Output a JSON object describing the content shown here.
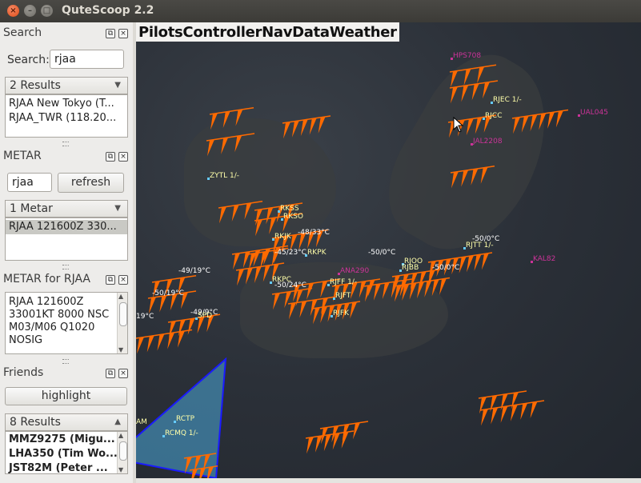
{
  "window": {
    "title": "QuteScoop 2.2"
  },
  "colors": {
    "titlebar": "#3c3b37",
    "wind_barb": "#ff6a00",
    "pilot": "#cc3399",
    "airport": "#ffffaa",
    "fir": "#4aa8d8"
  },
  "search": {
    "title": "Search",
    "label": "Search:",
    "value": "rjaa",
    "results_label": "2 Results",
    "results": [
      "RJAA New Tokyo (T...",
      "RJAA_TWR (118.20..."
    ]
  },
  "metar": {
    "title": "METAR",
    "input_value": "rjaa",
    "refresh_label": "refresh",
    "count_label": "1 Metar",
    "items": [
      "RJAA 121600Z 330..."
    ]
  },
  "metar_for": {
    "title": "METAR for RJAA",
    "lines": [
      "RJAA 121600Z",
      "33001KT 8000 NSC",
      "M03/M06 Q1020",
      "NOSIG"
    ]
  },
  "friends": {
    "title": "Friends",
    "highlight_label": "highlight",
    "count_label": "8 Results",
    "items": [
      "MMZ9275 (Migu...",
      "LHA350 (Tim Wo...",
      "JST82M (Peter ..."
    ]
  },
  "map": {
    "menu": [
      "Pilots",
      "Controller",
      "NavData",
      "Weather"
    ],
    "labels": [
      {
        "text": "HPS708",
        "kind": "pilot"
      },
      {
        "text": "RJEC 1/-",
        "kind": "airport"
      },
      {
        "text": "RJCC",
        "kind": "airport"
      },
      {
        "text": "UAL045",
        "kind": "pilot"
      },
      {
        "text": "JAL2208",
        "kind": "pilot"
      },
      {
        "text": "ZYTL 1/-",
        "kind": "airport"
      },
      {
        "text": "RKSS",
        "kind": "airport"
      },
      {
        "text": "RKSO",
        "kind": "airport"
      },
      {
        "text": "RKJK",
        "kind": "airport"
      },
      {
        "text": "-48/33°C",
        "kind": "temp"
      },
      {
        "text": "-45/23°C",
        "kind": "temp"
      },
      {
        "text": "RKPK",
        "kind": "airport"
      },
      {
        "text": "-50/0°C",
        "kind": "temp"
      },
      {
        "text": "ANA290",
        "kind": "pilot"
      },
      {
        "text": "RJOO",
        "kind": "airport"
      },
      {
        "text": "RJBB",
        "kind": "airport"
      },
      {
        "text": "-50/0°C",
        "kind": "temp"
      },
      {
        "text": "-50/0°C",
        "kind": "temp"
      },
      {
        "text": "RJTT 1/-",
        "kind": "airport"
      },
      {
        "text": "KAL82",
        "kind": "pilot"
      },
      {
        "text": "-49/19°C",
        "kind": "temp"
      },
      {
        "text": "RKPC",
        "kind": "airport"
      },
      {
        "text": "-50/24°C",
        "kind": "temp"
      },
      {
        "text": "RJFF 1/-",
        "kind": "airport"
      },
      {
        "text": "RJFT",
        "kind": "airport"
      },
      {
        "text": "-50/19°C",
        "kind": "temp"
      },
      {
        "text": "-49/9°C",
        "kind": "temp"
      },
      {
        "text": "RJFK",
        "kind": "airport"
      },
      {
        "text": "SPD",
        "kind": "airport"
      },
      {
        "text": "19°C",
        "kind": "temp"
      },
      {
        "text": "AM",
        "kind": "airport"
      },
      {
        "text": "RCTP",
        "kind": "airport"
      },
      {
        "text": "RCMQ 1/-",
        "kind": "airport"
      }
    ]
  }
}
